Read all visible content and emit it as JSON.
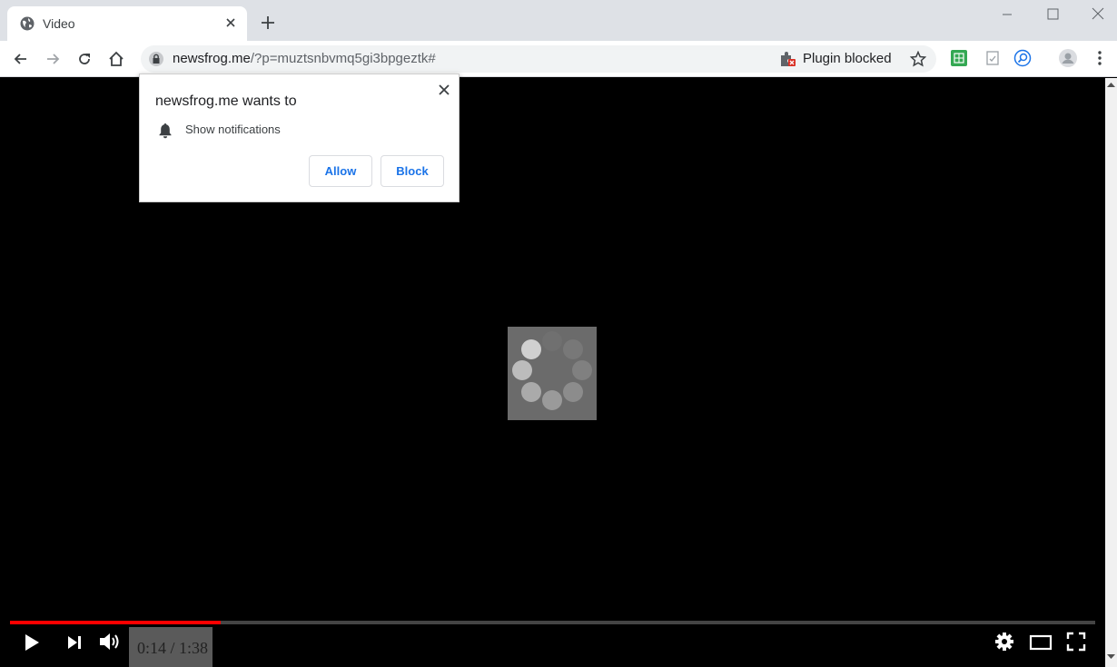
{
  "tab": {
    "title": "Video",
    "favicon": "globe-icon"
  },
  "toolbar": {
    "url_host": "newsfrog.me",
    "url_path": "/?p=muztsnbvmq5gi3bpgeztk#",
    "plugin_status": "Plugin blocked"
  },
  "popup": {
    "title": "newsfrog.me wants to",
    "permission": "Show notifications",
    "allow_label": "Allow",
    "block_label": "Block"
  },
  "player": {
    "time": "0:14 / 1:38",
    "progress": 0.194,
    "progress_color": "#ff0000"
  },
  "colors": {
    "titlebar": "#dee1e6",
    "omnibox": "#f1f3f4",
    "accent": "#1a73e8"
  }
}
